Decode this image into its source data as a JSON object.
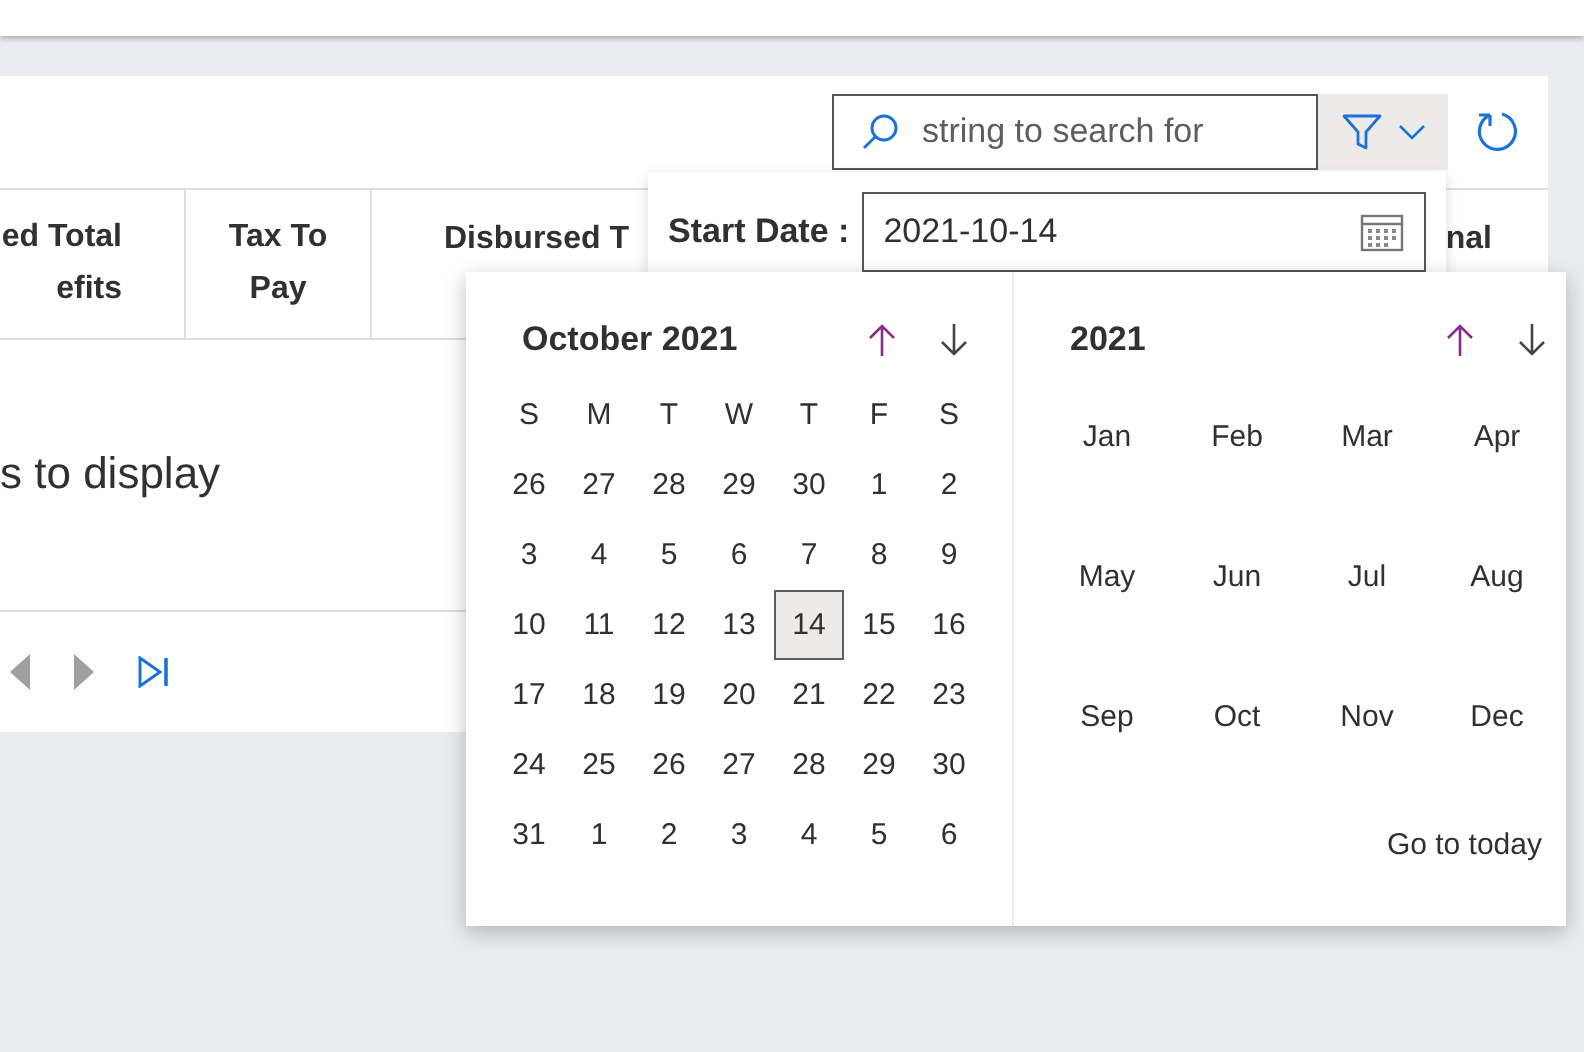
{
  "toolbar": {
    "search": {
      "placeholder": "string to search for"
    }
  },
  "table": {
    "columns": [
      {
        "lines": [
          "ed Total",
          "efits"
        ]
      },
      {
        "lines": [
          "Tax To",
          "Pay"
        ]
      },
      {
        "lines": [
          "Disbursed T"
        ]
      },
      {
        "lines": [
          "nal"
        ]
      }
    ],
    "empty_message": "s to display"
  },
  "pager": [
    {
      "kind": "prev",
      "disabled": true
    },
    {
      "kind": "next",
      "disabled": true
    },
    {
      "kind": "last",
      "disabled": false
    }
  ],
  "filter": {
    "start_date": {
      "label": "Start Date :",
      "value": "2021-10-14"
    }
  },
  "calendar": {
    "month_title": "October 2021",
    "weekdays": [
      "S",
      "M",
      "T",
      "W",
      "T",
      "F",
      "S"
    ],
    "days": [
      {
        "label": "26",
        "selected": false
      },
      {
        "label": "27",
        "selected": false
      },
      {
        "label": "28",
        "selected": false
      },
      {
        "label": "29",
        "selected": false
      },
      {
        "label": "30",
        "selected": false
      },
      {
        "label": "1",
        "selected": false
      },
      {
        "label": "2",
        "selected": false
      },
      {
        "label": "3",
        "selected": false
      },
      {
        "label": "4",
        "selected": false
      },
      {
        "label": "5",
        "selected": false
      },
      {
        "label": "6",
        "selected": false
      },
      {
        "label": "7",
        "selected": false
      },
      {
        "label": "8",
        "selected": false
      },
      {
        "label": "9",
        "selected": false
      },
      {
        "label": "10",
        "selected": false
      },
      {
        "label": "11",
        "selected": false
      },
      {
        "label": "12",
        "selected": false
      },
      {
        "label": "13",
        "selected": false
      },
      {
        "label": "14",
        "selected": true
      },
      {
        "label": "15",
        "selected": false
      },
      {
        "label": "16",
        "selected": false
      },
      {
        "label": "17",
        "selected": false
      },
      {
        "label": "18",
        "selected": false
      },
      {
        "label": "19",
        "selected": false
      },
      {
        "label": "20",
        "selected": false
      },
      {
        "label": "21",
        "selected": false
      },
      {
        "label": "22",
        "selected": false
      },
      {
        "label": "23",
        "selected": false
      },
      {
        "label": "24",
        "selected": false
      },
      {
        "label": "25",
        "selected": false
      },
      {
        "label": "26",
        "selected": false
      },
      {
        "label": "27",
        "selected": false
      },
      {
        "label": "28",
        "selected": false
      },
      {
        "label": "29",
        "selected": false
      },
      {
        "label": "30",
        "selected": false
      },
      {
        "label": "31",
        "selected": false
      },
      {
        "label": "1",
        "selected": false
      },
      {
        "label": "2",
        "selected": false
      },
      {
        "label": "3",
        "selected": false
      },
      {
        "label": "4",
        "selected": false
      },
      {
        "label": "5",
        "selected": false
      },
      {
        "label": "6",
        "selected": false
      }
    ],
    "year_title": "2021",
    "months": [
      "Jan",
      "Feb",
      "Mar",
      "Apr",
      "May",
      "Jun",
      "Jul",
      "Aug",
      "Sep",
      "Oct",
      "Nov",
      "Dec"
    ],
    "go_today": "Go to today"
  }
}
